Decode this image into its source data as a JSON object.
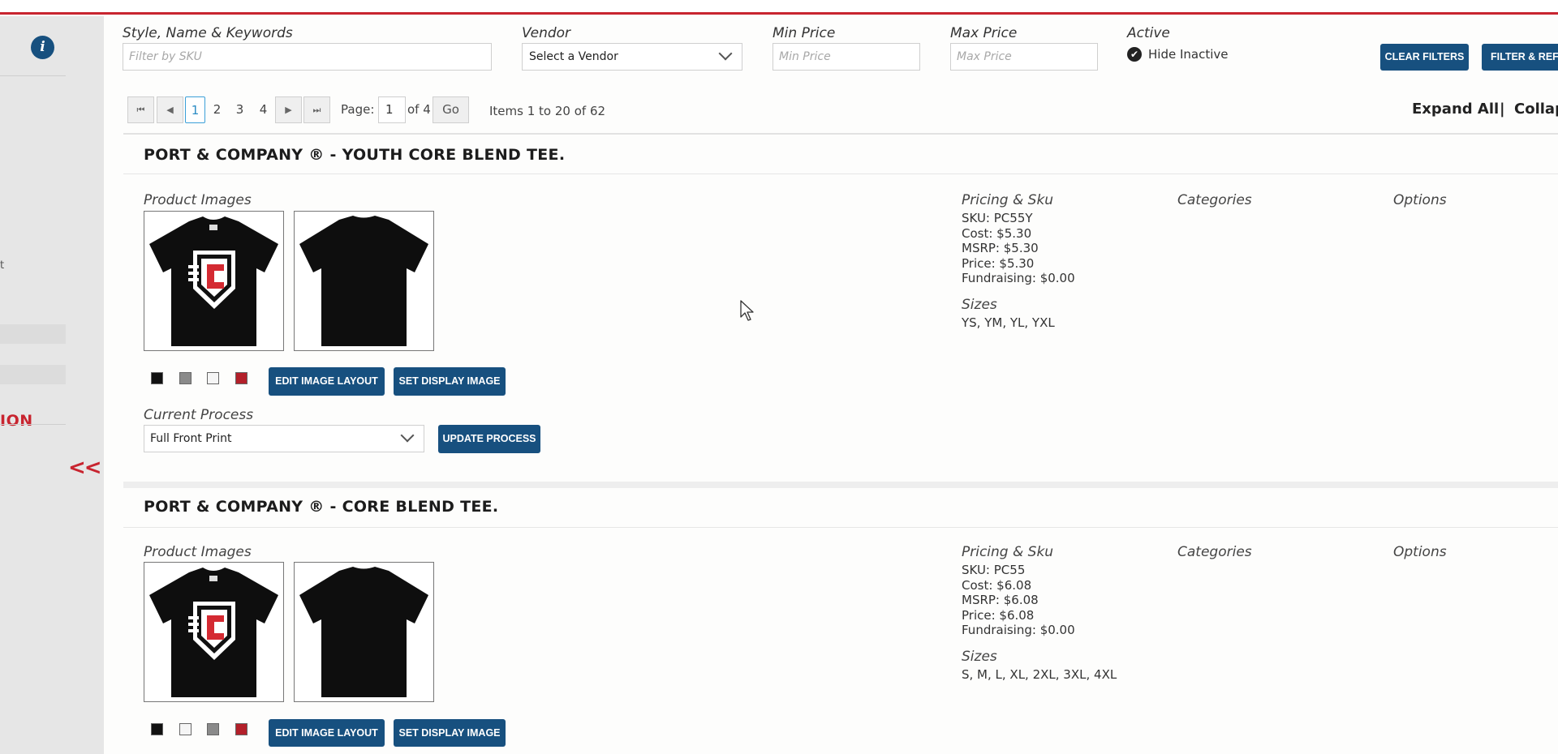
{
  "sidebar": {
    "frag_text": "t",
    "red_label": "ION",
    "collapse_label": "<<"
  },
  "filters": {
    "keywords_label": "Style, Name & Keywords",
    "keywords_placeholder": "Filter by SKU",
    "vendor_label": "Vendor",
    "vendor_value": "Select a Vendor",
    "min_price_label": "Min Price",
    "min_price_placeholder": "Min Price",
    "max_price_label": "Max Price",
    "max_price_placeholder": "Max Price",
    "active_label": "Active",
    "hide_inactive_label": "Hide Inactive",
    "clear_button": "CLEAR FILTERS",
    "filter_button": "FILTER & REFRESH"
  },
  "pager": {
    "first_icon": "first-page-icon",
    "prev_icon": "prev-page-icon",
    "next_icon": "next-page-icon",
    "last_icon": "last-page-icon",
    "pages": [
      "1",
      "2",
      "3",
      "4"
    ],
    "current_page": "1",
    "page_label": "Page:",
    "page_input_value": "1",
    "of_label": "of 4",
    "go_label": "Go",
    "items_text": "Items 1 to 20 of 62",
    "expand_all": "Expand All",
    "separator": "|",
    "collapse_all": "Collapse All"
  },
  "products": [
    {
      "title": "PORT & COMPANY ® - YOUTH CORE BLEND TEE.",
      "images_label": "Product Images",
      "swatch_colors": [
        "#111111",
        "#8a8a8a",
        "#f5f5f5",
        "#b3202a"
      ],
      "edit_layout_button": "EDIT IMAGE LAYOUT",
      "set_display_button": "SET DISPLAY IMAGE",
      "process_label": "Current Process",
      "process_value": "Full Front Print",
      "update_process_button": "UPDATE PROCESS",
      "pricing_label": "Pricing & Sku",
      "sku": "SKU: PC55Y",
      "cost": "Cost: $5.30",
      "msrp": "MSRP: $5.30",
      "price": "Price: $5.30",
      "fundraising": "Fundraising: $0.00",
      "sizes_label": "Sizes",
      "sizes": "YS, YM, YL, YXL",
      "categories_label": "Categories",
      "options_label": "Options"
    },
    {
      "title": "PORT & COMPANY ® - CORE BLEND TEE.",
      "images_label": "Product Images",
      "swatch_colors": [
        "#111111",
        "#f5f5f5",
        "#8a8a8a",
        "#b3202a"
      ],
      "edit_layout_button": "EDIT IMAGE LAYOUT",
      "set_display_button": "SET DISPLAY IMAGE",
      "pricing_label": "Pricing & Sku",
      "sku": "SKU: PC55",
      "cost": "Cost: $6.08",
      "msrp": "MSRP: $6.08",
      "price": "Price: $6.08",
      "fundraising": "Fundraising: $0.00",
      "sizes_label": "Sizes",
      "sizes": "S, M, L, XL, 2XL, 3XL, 4XL",
      "categories_label": "Categories",
      "options_label": "Options"
    }
  ],
  "colors": {
    "brand_blue": "#17507f",
    "accent_red": "#c8242f"
  }
}
